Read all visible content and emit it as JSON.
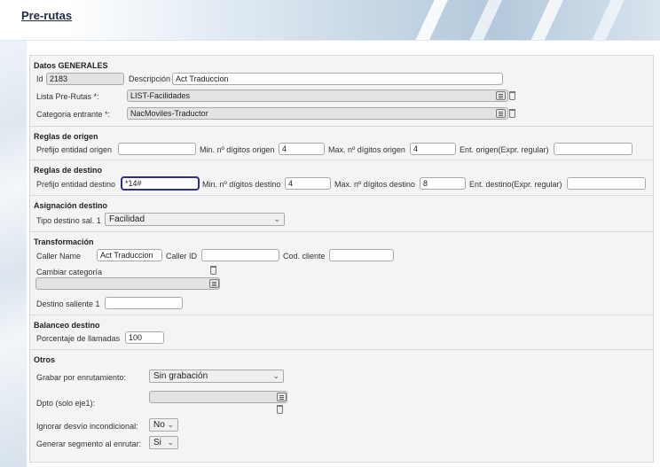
{
  "page": {
    "title": "Pre-rutas"
  },
  "generales": {
    "section": "Datos GENERALES",
    "id_label": "Id",
    "id_value": "2183",
    "descripcion_label": "Descripción",
    "descripcion_value": "Act Traduccion",
    "lista_label": "Lista Pre-Rutas *:",
    "lista_value": "LIST-Facilidades",
    "categoria_label": "Categoria entrante *:",
    "categoria_value": "NacMoviles-Traductor"
  },
  "origen": {
    "section": "Reglas de origen",
    "prefijo_label": "Prefijo entidad origen",
    "prefijo_value": "",
    "min_label": "Min. nº dígitos origen",
    "min_value": "4",
    "max_label": "Max. nº dígitos origen",
    "max_value": "4",
    "ent_label": "Ent. origen(Expr. regular)",
    "ent_value": ""
  },
  "destino": {
    "section": "Reglas de destino",
    "prefijo_label": "Prefijo entidad destino",
    "prefijo_value": "*14#",
    "min_label": "Min. nº dígitos destino",
    "min_value": "4",
    "max_label": "Max. nº dígitos destino",
    "max_value": "8",
    "ent_label": "Ent. destino(Expr. regular)",
    "ent_value": ""
  },
  "asignacion": {
    "section": "Asignación destino",
    "tipo_label": "Tipo destino sal. 1",
    "tipo_value": "Facilidad"
  },
  "transformacion": {
    "section": "Transformación",
    "caller_name_label": "Caller Name",
    "caller_name_value": "Act Traduccion",
    "caller_id_label": "Caller ID",
    "caller_id_value": "",
    "cod_cliente_label": "Cod. cliente",
    "cod_cliente_value": "",
    "cambiar_label": "Cambiar categoría",
    "cambiar_value": "",
    "destino_saliente_label": "Destino saliente 1",
    "destino_saliente_value": ""
  },
  "balanceo": {
    "section": "Balanceo destino",
    "porcentaje_label": "Porcentaje de llamadas",
    "porcentaje_value": "100"
  },
  "otros": {
    "section": "Otros",
    "grabar_label": "Grabar por enrutamiento:",
    "grabar_value": "Sin grabación",
    "dpto_label": "Dpto (solo eje1):",
    "dpto_value": "",
    "ignorar_label": "Ignorar desvío incondicional:",
    "ignorar_value": "No",
    "generar_label": "Generar segmento al enrutar:",
    "generar_value": "Si"
  },
  "icons": {
    "list": "list-icon",
    "delete": "trash-icon",
    "dropdown": "chevron-down-icon"
  }
}
